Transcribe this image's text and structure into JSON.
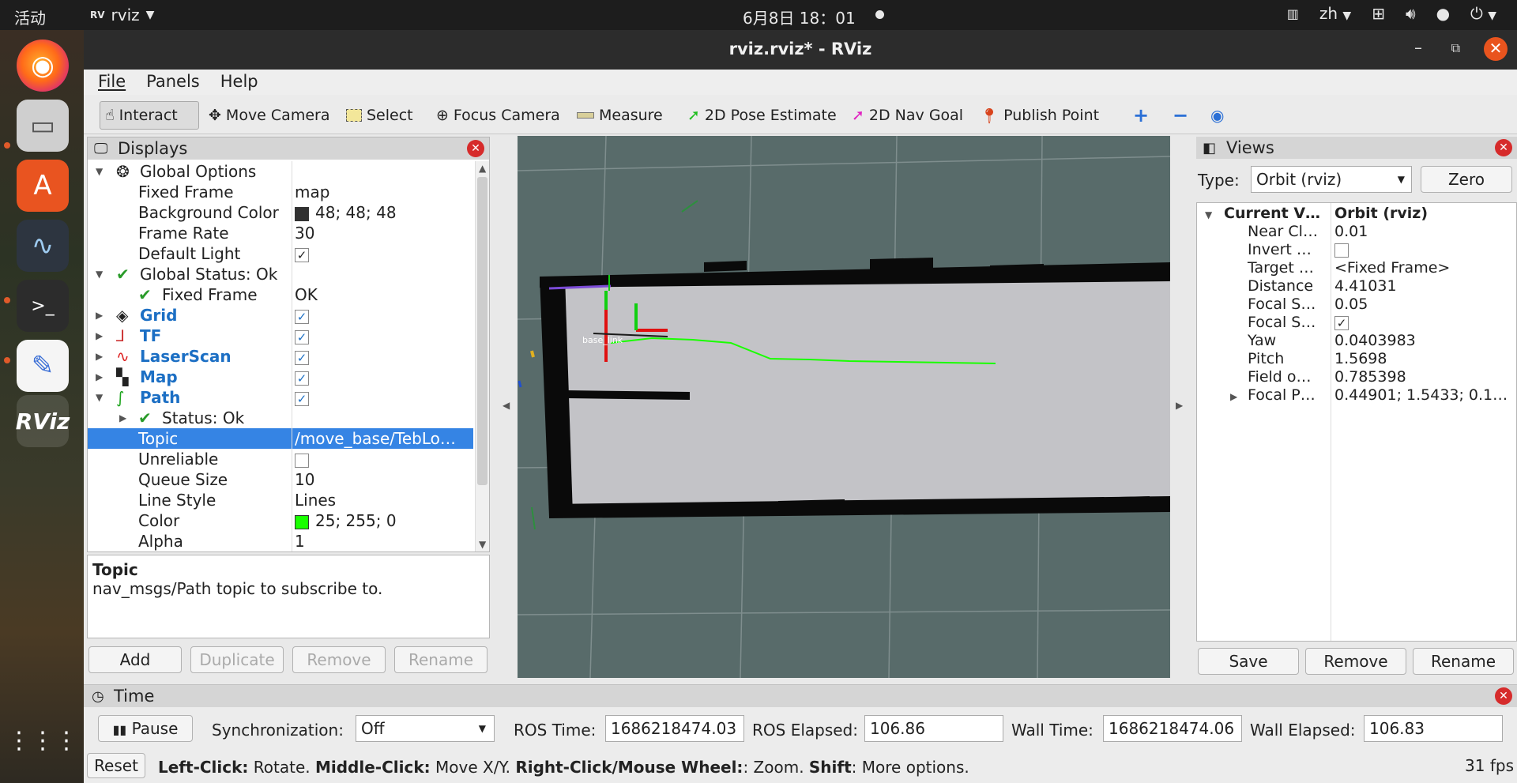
{
  "topbar": {
    "activities": "活动",
    "app_name": "rviz",
    "clock": "6月8日  18：01",
    "lang": "zh"
  },
  "window": {
    "title": "rviz.rviz* - RViz"
  },
  "menu": {
    "file": "File",
    "panels": "Panels",
    "help": "Help"
  },
  "toolbar": {
    "interact": "Interact",
    "move_camera": "Move Camera",
    "select": "Select",
    "focus_camera": "Focus Camera",
    "measure": "Measure",
    "pose_estimate": "2D Pose Estimate",
    "nav_goal": "2D Nav Goal",
    "publish_point": "Publish Point"
  },
  "displays": {
    "title": "Displays",
    "rows": {
      "global_options": "Global Options",
      "fixed_frame": "Fixed Frame",
      "fixed_frame_val": "map",
      "background_color": "Background Color",
      "background_color_val": "48; 48; 48",
      "frame_rate": "Frame Rate",
      "frame_rate_val": "30",
      "default_light": "Default Light",
      "global_status": "Global Status: Ok",
      "status_fixed_frame": "Fixed Frame",
      "status_fixed_frame_val": "OK",
      "grid": "Grid",
      "tf": "TF",
      "laserscan": "LaserScan",
      "map": "Map",
      "path": "Path",
      "path_status": "Status: Ok",
      "topic": "Topic",
      "topic_val": "/move_base/TebLo…",
      "unreliable": "Unreliable",
      "queue_size": "Queue Size",
      "queue_size_val": "10",
      "line_style": "Line Style",
      "line_style_val": "Lines",
      "color": "Color",
      "color_val": "25; 255; 0",
      "alpha": "Alpha",
      "alpha_val": "1"
    },
    "desc_title": "Topic",
    "desc_text": "nav_msgs/Path topic to subscribe to.",
    "buttons": {
      "add": "Add",
      "duplicate": "Duplicate",
      "remove": "Remove",
      "rename": "Rename"
    }
  },
  "views": {
    "title": "Views",
    "type_label": "Type:",
    "type_val": "Orbit (rviz)",
    "zero": "Zero",
    "rows": {
      "current": "Current V…",
      "current_val": "Orbit (rviz)",
      "near": "Near Cl…",
      "near_val": "0.01",
      "invert": "Invert …",
      "target": "Target …",
      "target_val": "<Fixed Frame>",
      "distance": "Distance",
      "distance_val": "4.41031",
      "focal_s1": "Focal S…",
      "focal_s1_val": "0.05",
      "focal_s2": "Focal S…",
      "yaw": "Yaw",
      "yaw_val": "0.0403983",
      "pitch": "Pitch",
      "pitch_val": "1.5698",
      "field": "Field o…",
      "field_val": "0.785398",
      "focal_p": "Focal P…",
      "focal_p_val": "0.44901; 1.5433; 0.1…"
    },
    "buttons": {
      "save": "Save",
      "remove": "Remove",
      "rename": "Rename"
    }
  },
  "time": {
    "title": "Time",
    "pause": "Pause",
    "sync_label": "Synchronization:",
    "sync_val": "Off",
    "ros_time_label": "ROS Time:",
    "ros_time_val": "1686218474.03",
    "ros_elapsed_label": "ROS Elapsed:",
    "ros_elapsed_val": "106.86",
    "wall_time_label": "Wall Time:",
    "wall_time_val": "1686218474.06",
    "wall_elapsed_label": "Wall Elapsed:",
    "wall_elapsed_val": "106.83"
  },
  "status": {
    "reset": "Reset",
    "k1": "Left-Click:",
    "t1": " Rotate. ",
    "k2": "Middle-Click:",
    "t2": " Move X/Y. ",
    "k3": "Right-Click/Mouse Wheel:",
    "t3": ": Zoom. ",
    "k4": "Shift",
    "t4": ": More options.",
    "fps": "31 fps"
  },
  "viewport": {
    "frame_labels": "base_link",
    "path_color": "#19ff00",
    "background": "#586b6a"
  }
}
